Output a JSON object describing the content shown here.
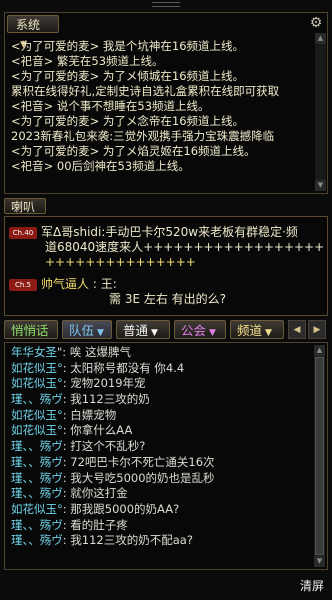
{
  "system": {
    "dropdown_label": "系统",
    "lines": [
      "<为了可爱的麦> 我是个坑神在16频道上线。",
      "<祀音> 繁芜在53频道上线。",
      "<为了可爱的麦> 为了メ倾城在16频道上线。",
      "累积在线得好礼,定制史诗自选礼盒累积在线即可获取",
      "<祀音> 说个事不想睡在53频道上线。",
      "<为了可爱的麦> 为了メ念帝在16频道上线。",
      "2023新春礼包来袭:三觉外观携手强力宝珠震撼降临",
      "<为了可爱的麦> 为了メ焰灵姬在16频道上线。",
      "<祀音> 00后剑神在53频道上线。"
    ]
  },
  "horn": {
    "label": "喇叭",
    "msg1": {
      "badge": "Ch.40",
      "line1": "军Δ哥shidi:手动巴卡尔520w来老板有群稳定·频",
      "line2": "道68040速度来人+++++++++++++++++++++++++",
      "line3": "+++++++++++++++"
    },
    "msg2": {
      "badge": "Ch.5",
      "name": "帅气逼人",
      "colon": ":",
      "line1": "王:",
      "line2": "需  3E  左右   有出的么?"
    }
  },
  "tabs": {
    "t1": "悄悄话",
    "t2": "队伍",
    "t3": "普通",
    "t4": "公会",
    "t5": "频道"
  },
  "chat": {
    "lines": [
      {
        "name": "年华女圣",
        "text": "\": 唉 这爆脾气"
      },
      {
        "name": "如花似玉°",
        "text": ": 太阳称号都没有  你4.4"
      },
      {
        "name": "如花似玉°",
        "text": ": 宠物2019年宠"
      },
      {
        "name": "瑾、、殇ヴ",
        "text": ": 我112三攻的奶"
      },
      {
        "name": "如花似玉°",
        "text": ": 白嫖宠物"
      },
      {
        "name": "如花似玉°",
        "text": ": 你拿什么AA"
      },
      {
        "name": "瑾、、殇ヴ",
        "text": ": 打这个不乱秒?"
      },
      {
        "name": "瑾、、殇ヴ",
        "text": ": 72吧巴卡尔不死亡通关16次"
      },
      {
        "name": "瑾、、殇ヴ",
        "text": ": 我大号吃5000的奶也是乱秒"
      },
      {
        "name": "瑾、、殇ヴ",
        "text": ": 就你这打金"
      },
      {
        "name": "如花似玉°",
        "text": ": 那我跟5000的奶AA?"
      },
      {
        "name": "瑾、、殇ヴ",
        "text": ": 看的肚子疼"
      },
      {
        "name": "瑾、、殇ヴ",
        "text": ": 我112三攻的奶不配aa?"
      }
    ]
  },
  "footer": {
    "clear_label": "清屏"
  },
  "colors": {
    "name_cyan": "#6ed2e8",
    "gold": "#f2dc6e",
    "badge_red": "#8c1c13",
    "badge_green": "#2b6a27"
  },
  "icons": {
    "gear": "gear-icon",
    "dropdown": "chevron-down-icon"
  }
}
